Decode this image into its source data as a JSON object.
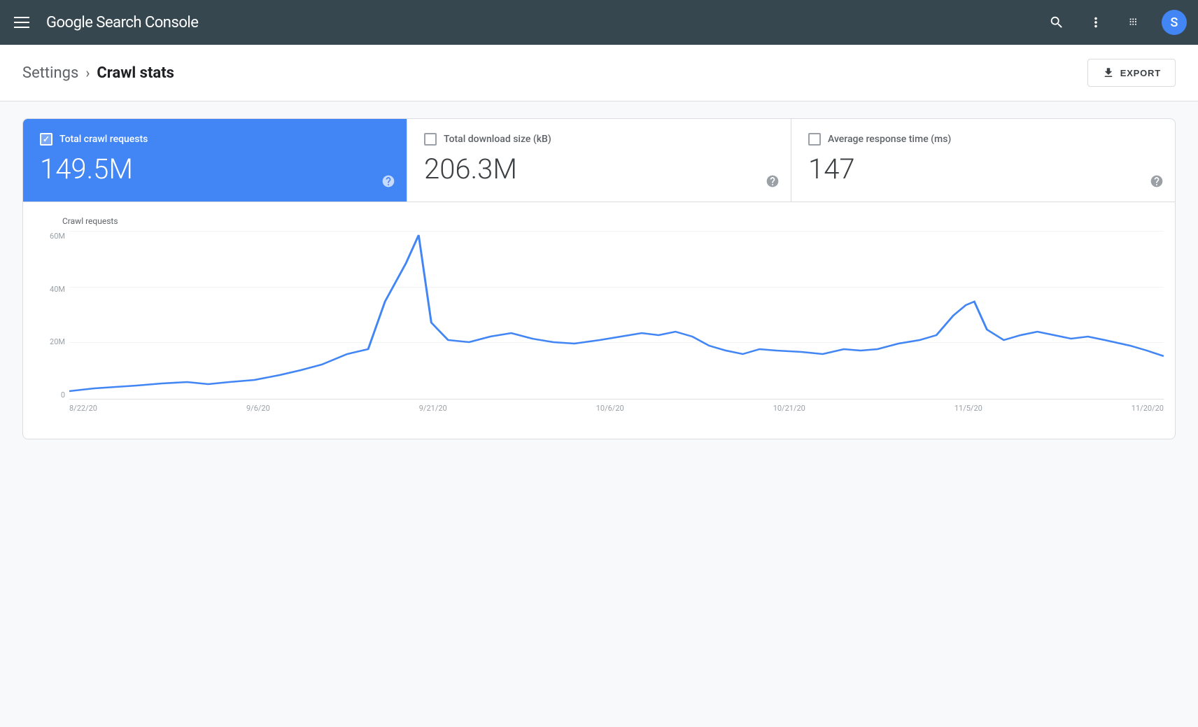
{
  "header": {
    "title": "Google Search Console",
    "title_google": "Google ",
    "title_search_console": "Search Console",
    "avatar_letter": "S"
  },
  "breadcrumb": {
    "settings_label": "Settings",
    "current_label": "Crawl stats"
  },
  "toolbar": {
    "export_label": "EXPORT"
  },
  "stats": {
    "card1": {
      "label": "Total crawl requests",
      "value": "149.5M",
      "active": true
    },
    "card2": {
      "label": "Total download size (kB)",
      "value": "206.3M",
      "active": false
    },
    "card3": {
      "label": "Average response time (ms)",
      "value": "147",
      "active": false
    }
  },
  "chart": {
    "label": "Crawl requests",
    "y_axis": [
      "0",
      "20M",
      "40M",
      "60M"
    ],
    "x_axis": [
      "8/22/20",
      "9/6/20",
      "9/21/20",
      "10/6/20",
      "10/21/20",
      "11/5/20",
      "11/20/20"
    ]
  }
}
